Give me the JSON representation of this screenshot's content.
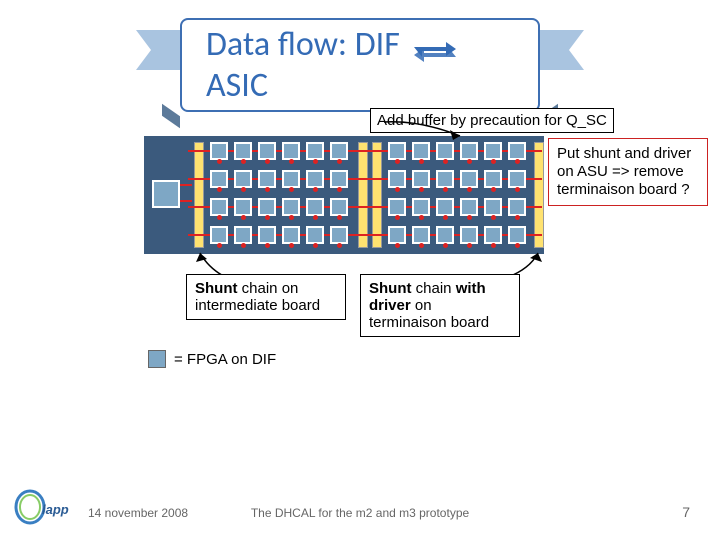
{
  "title_prefix": "Data flow: DIF",
  "title_suffix": "ASIC",
  "buffer_note": "Add buffer by precaution for Q_SC",
  "asu_note": "Put shunt and driver on ASU => remove terminaison board ?",
  "shunt_intermediate": "Shunt chain on intermediate board",
  "shunt_terminaison": "Shunt chain with driver on terminaison board",
  "fpga_legend": "= FPGA on DIF",
  "footer": {
    "date": "14 november 2008",
    "center": "The DHCAL for the m2 and m3 prototype",
    "page": "7"
  }
}
